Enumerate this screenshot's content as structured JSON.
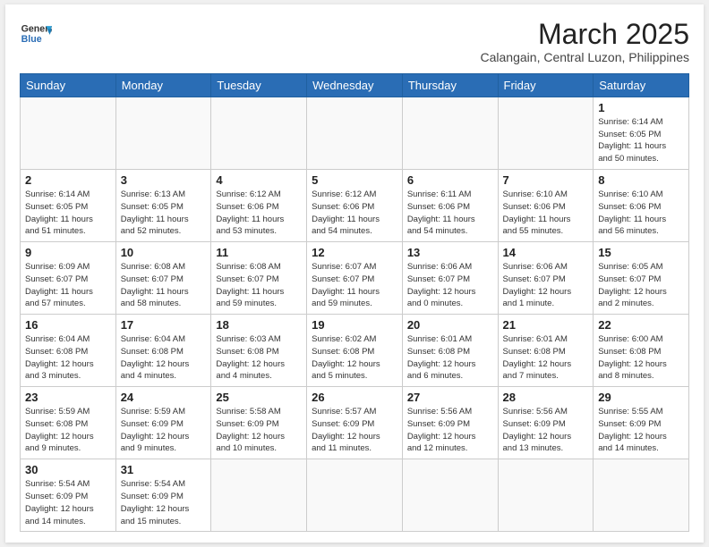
{
  "header": {
    "logo_line1": "General",
    "logo_line2": "Blue",
    "month": "March 2025",
    "location": "Calangain, Central Luzon, Philippines"
  },
  "weekdays": [
    "Sunday",
    "Monday",
    "Tuesday",
    "Wednesday",
    "Thursday",
    "Friday",
    "Saturday"
  ],
  "weeks": [
    [
      {
        "day": "",
        "info": ""
      },
      {
        "day": "",
        "info": ""
      },
      {
        "day": "",
        "info": ""
      },
      {
        "day": "",
        "info": ""
      },
      {
        "day": "",
        "info": ""
      },
      {
        "day": "",
        "info": ""
      },
      {
        "day": "1",
        "info": "Sunrise: 6:14 AM\nSunset: 6:05 PM\nDaylight: 11 hours\nand 50 minutes."
      }
    ],
    [
      {
        "day": "2",
        "info": "Sunrise: 6:14 AM\nSunset: 6:05 PM\nDaylight: 11 hours\nand 51 minutes."
      },
      {
        "day": "3",
        "info": "Sunrise: 6:13 AM\nSunset: 6:05 PM\nDaylight: 11 hours\nand 52 minutes."
      },
      {
        "day": "4",
        "info": "Sunrise: 6:12 AM\nSunset: 6:06 PM\nDaylight: 11 hours\nand 53 minutes."
      },
      {
        "day": "5",
        "info": "Sunrise: 6:12 AM\nSunset: 6:06 PM\nDaylight: 11 hours\nand 54 minutes."
      },
      {
        "day": "6",
        "info": "Sunrise: 6:11 AM\nSunset: 6:06 PM\nDaylight: 11 hours\nand 54 minutes."
      },
      {
        "day": "7",
        "info": "Sunrise: 6:10 AM\nSunset: 6:06 PM\nDaylight: 11 hours\nand 55 minutes."
      },
      {
        "day": "8",
        "info": "Sunrise: 6:10 AM\nSunset: 6:06 PM\nDaylight: 11 hours\nand 56 minutes."
      }
    ],
    [
      {
        "day": "9",
        "info": "Sunrise: 6:09 AM\nSunset: 6:07 PM\nDaylight: 11 hours\nand 57 minutes."
      },
      {
        "day": "10",
        "info": "Sunrise: 6:08 AM\nSunset: 6:07 PM\nDaylight: 11 hours\nand 58 minutes."
      },
      {
        "day": "11",
        "info": "Sunrise: 6:08 AM\nSunset: 6:07 PM\nDaylight: 11 hours\nand 59 minutes."
      },
      {
        "day": "12",
        "info": "Sunrise: 6:07 AM\nSunset: 6:07 PM\nDaylight: 11 hours\nand 59 minutes."
      },
      {
        "day": "13",
        "info": "Sunrise: 6:06 AM\nSunset: 6:07 PM\nDaylight: 12 hours\nand 0 minutes."
      },
      {
        "day": "14",
        "info": "Sunrise: 6:06 AM\nSunset: 6:07 PM\nDaylight: 12 hours\nand 1 minute."
      },
      {
        "day": "15",
        "info": "Sunrise: 6:05 AM\nSunset: 6:07 PM\nDaylight: 12 hours\nand 2 minutes."
      }
    ],
    [
      {
        "day": "16",
        "info": "Sunrise: 6:04 AM\nSunset: 6:08 PM\nDaylight: 12 hours\nand 3 minutes."
      },
      {
        "day": "17",
        "info": "Sunrise: 6:04 AM\nSunset: 6:08 PM\nDaylight: 12 hours\nand 4 minutes."
      },
      {
        "day": "18",
        "info": "Sunrise: 6:03 AM\nSunset: 6:08 PM\nDaylight: 12 hours\nand 4 minutes."
      },
      {
        "day": "19",
        "info": "Sunrise: 6:02 AM\nSunset: 6:08 PM\nDaylight: 12 hours\nand 5 minutes."
      },
      {
        "day": "20",
        "info": "Sunrise: 6:01 AM\nSunset: 6:08 PM\nDaylight: 12 hours\nand 6 minutes."
      },
      {
        "day": "21",
        "info": "Sunrise: 6:01 AM\nSunset: 6:08 PM\nDaylight: 12 hours\nand 7 minutes."
      },
      {
        "day": "22",
        "info": "Sunrise: 6:00 AM\nSunset: 6:08 PM\nDaylight: 12 hours\nand 8 minutes."
      }
    ],
    [
      {
        "day": "23",
        "info": "Sunrise: 5:59 AM\nSunset: 6:08 PM\nDaylight: 12 hours\nand 9 minutes."
      },
      {
        "day": "24",
        "info": "Sunrise: 5:59 AM\nSunset: 6:09 PM\nDaylight: 12 hours\nand 9 minutes."
      },
      {
        "day": "25",
        "info": "Sunrise: 5:58 AM\nSunset: 6:09 PM\nDaylight: 12 hours\nand 10 minutes."
      },
      {
        "day": "26",
        "info": "Sunrise: 5:57 AM\nSunset: 6:09 PM\nDaylight: 12 hours\nand 11 minutes."
      },
      {
        "day": "27",
        "info": "Sunrise: 5:56 AM\nSunset: 6:09 PM\nDaylight: 12 hours\nand 12 minutes."
      },
      {
        "day": "28",
        "info": "Sunrise: 5:56 AM\nSunset: 6:09 PM\nDaylight: 12 hours\nand 13 minutes."
      },
      {
        "day": "29",
        "info": "Sunrise: 5:55 AM\nSunset: 6:09 PM\nDaylight: 12 hours\nand 14 minutes."
      }
    ],
    [
      {
        "day": "30",
        "info": "Sunrise: 5:54 AM\nSunset: 6:09 PM\nDaylight: 12 hours\nand 14 minutes."
      },
      {
        "day": "31",
        "info": "Sunrise: 5:54 AM\nSunset: 6:09 PM\nDaylight: 12 hours\nand 15 minutes."
      },
      {
        "day": "",
        "info": ""
      },
      {
        "day": "",
        "info": ""
      },
      {
        "day": "",
        "info": ""
      },
      {
        "day": "",
        "info": ""
      },
      {
        "day": "",
        "info": ""
      }
    ]
  ]
}
